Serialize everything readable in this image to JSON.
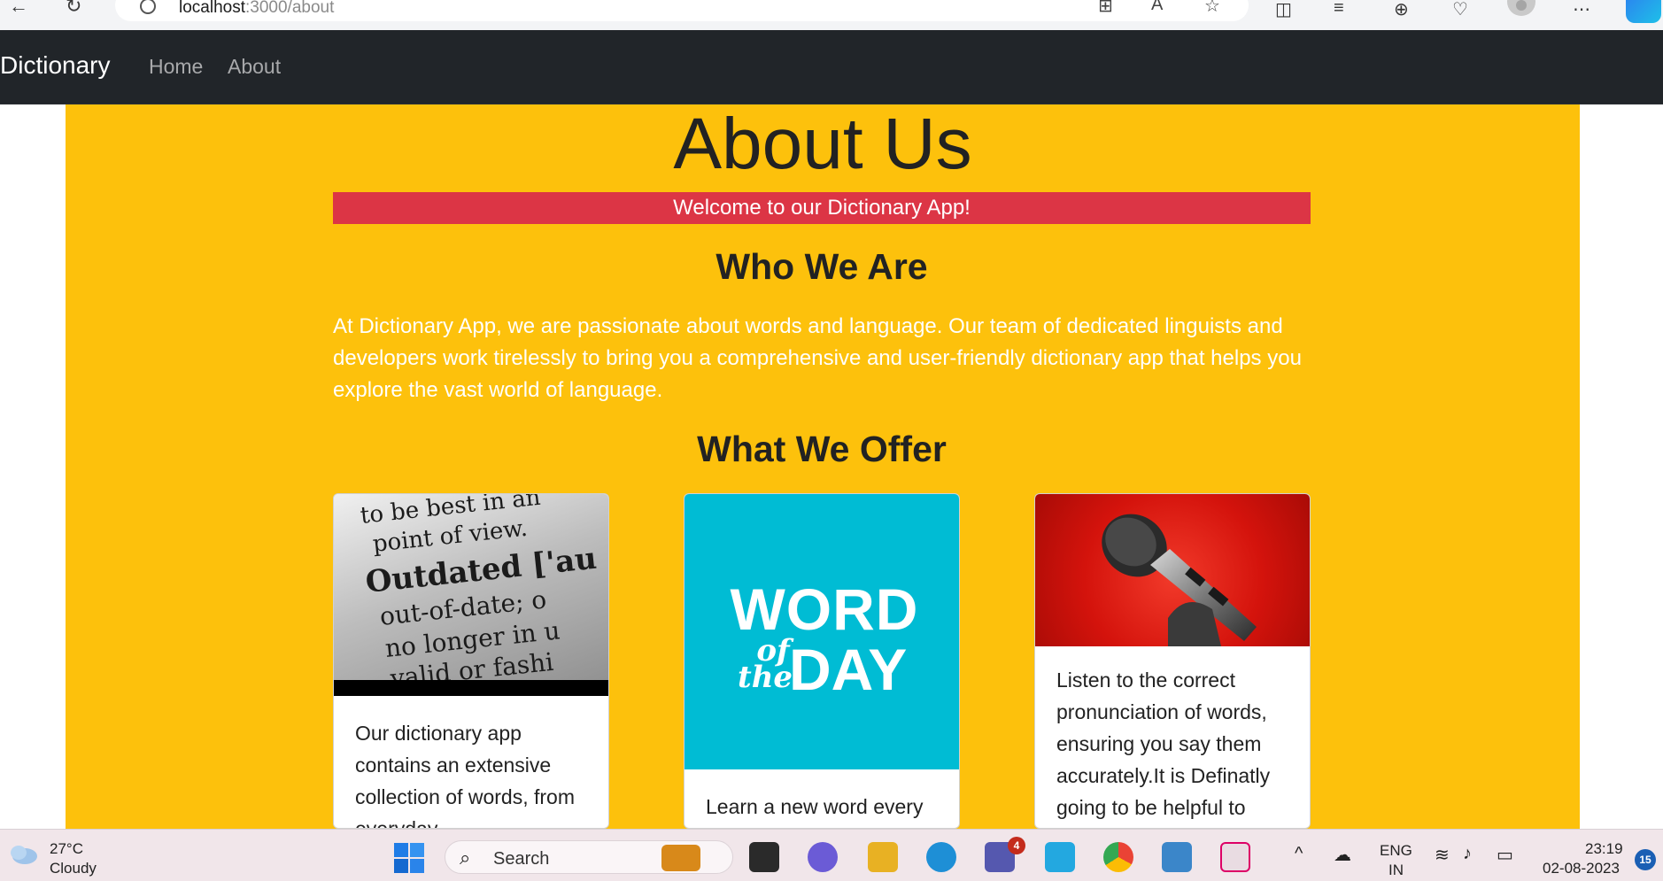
{
  "browser": {
    "url_host": "localhost",
    "url_path": ":3000/about"
  },
  "navbar": {
    "brand": "Dictionary",
    "links": [
      "Home",
      "About"
    ]
  },
  "page": {
    "title": "About Us",
    "welcome": "Welcome to our Dictionary App!",
    "who_heading": "Who We Are",
    "who_text": "At Dictionary App, we are passionate about words and language. Our team of dedicated linguists and developers work tirelessly to bring you a comprehensive and user-friendly dictionary app that helps you explore the vast world of language.",
    "offer_heading": "What We Offer",
    "cards": [
      {
        "text": "Our dictionary app contains an extensive collection of words, from everyday",
        "image": "dictionary-page-image"
      },
      {
        "text": "Learn a new word every",
        "image": "word-of-the-day-image",
        "img_word": "WORD",
        "img_of": "of",
        "img_the": "the",
        "img_day": "DAY"
      },
      {
        "text": "Listen to the correct pronunciation of words, ensuring you say them accurately.It is Definatly going to be helpful to",
        "image": "microphone-image"
      }
    ],
    "dict_image_lines": [
      "to be best in an",
      "point of view.",
      "Outdated ['au",
      "out-of-date; o",
      "no longer in u",
      "valid or fashi"
    ]
  },
  "taskbar": {
    "weather_temp": "27°C",
    "weather_desc": "Cloudy",
    "search_placeholder": "Search",
    "teams_badge": "4",
    "lang_primary": "ENG",
    "lang_secondary": "IN",
    "time": "23:19",
    "date": "02-08-2023",
    "notification_count": "15"
  },
  "colors": {
    "navbar_bg": "#212529",
    "page_bg": "#fdc10c",
    "welcome_bg": "#dc3545",
    "wotd_bg": "#00bcd4"
  }
}
